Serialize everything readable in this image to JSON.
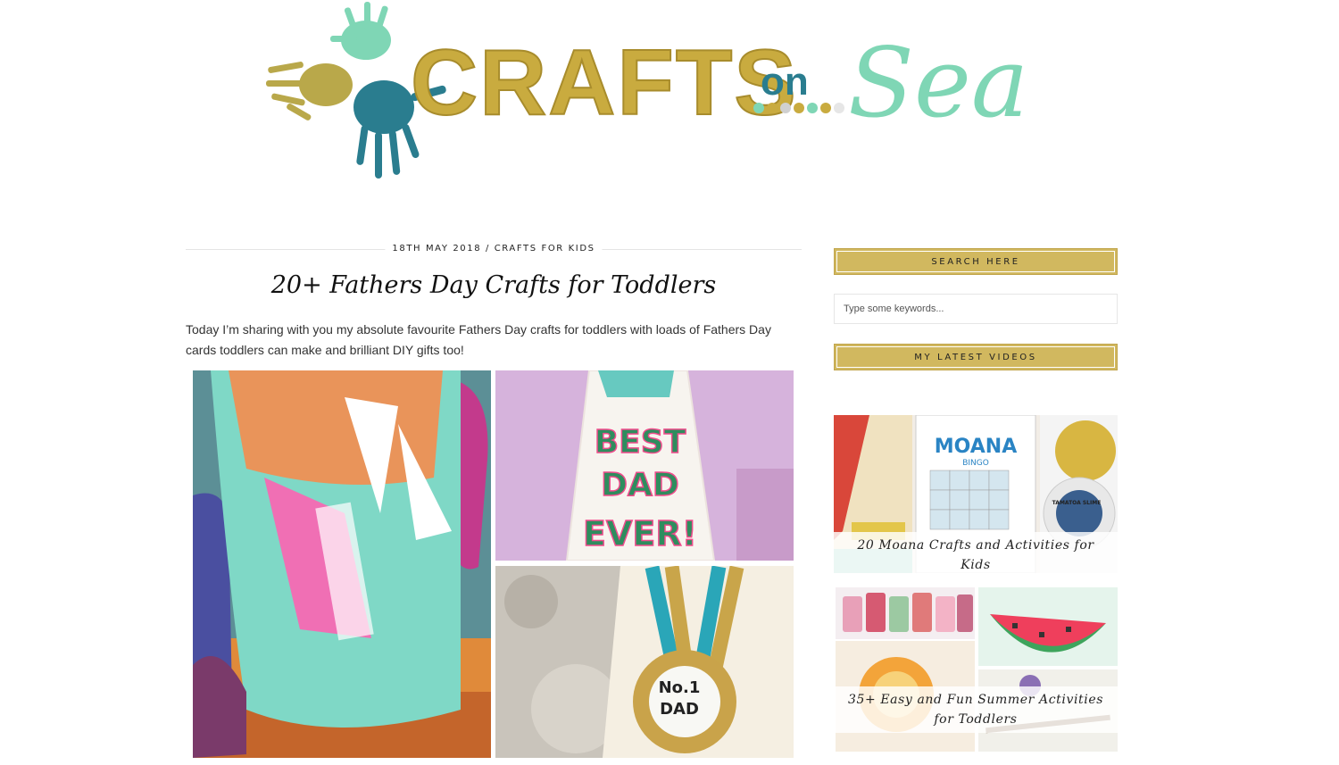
{
  "site": {
    "logo_text_main": "CRAFTS",
    "logo_text_on": "on",
    "logo_text_sea": "Sea"
  },
  "post": {
    "meta": "18TH MAY 2018 / CRAFTS FOR KIDS",
    "title": "20+ Fathers Day Crafts for Toddlers",
    "intro": "Today I’m sharing with you my absolute favourite Fathers Day crafts for toddlers with loads of Fathers Day cards toddlers can make and brilliant DIY gifts too!",
    "images": {
      "tie_text_1": "BEST",
      "tie_text_2": "DAD",
      "tie_text_3": "EVER!",
      "medal_text_1": "No.1",
      "medal_text_2": "DAD"
    }
  },
  "sidebar": {
    "search_title": "SEARCH HERE",
    "search_placeholder": "Type some keywords...",
    "videos_title": "MY LATEST VIDEOS",
    "videos": [
      {
        "caption": "20 Moana Crafts and Activities for Kids",
        "poster_title": "MOANA",
        "poster_sub": "BINGO",
        "jar_label": "TAMATOA SLIME"
      },
      {
        "caption": "35+ Easy and Fun Summer Activities for Toddlers"
      }
    ]
  },
  "colors": {
    "gold": "#d1b85f",
    "logo_gold": "#c9ab3f",
    "logo_mint": "#7fd6b5",
    "logo_teal": "#2a7d8f"
  }
}
